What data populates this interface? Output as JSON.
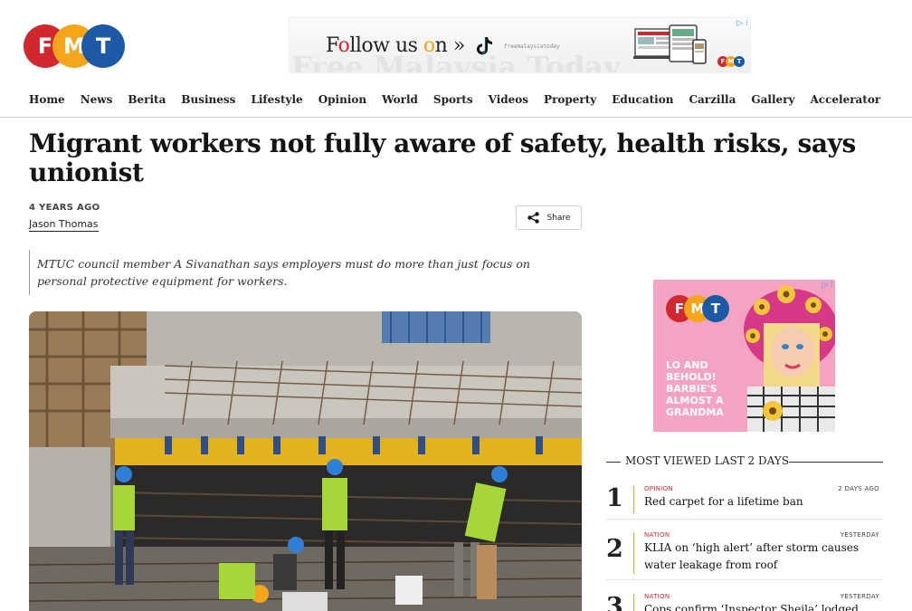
{
  "logo": {
    "letters": [
      "F",
      "M",
      "T"
    ],
    "colors": [
      "#d0282e",
      "#f4a51c",
      "#1d5aa6"
    ]
  },
  "top_ad": {
    "follow_text_pre": "F",
    "follow_text_o": "o",
    "follow_text_mid": "llow us ",
    "follow_text_o2": "o",
    "follow_text_post": "n »",
    "handle": "freemalaysiatoday",
    "ghost_text": "Free Malaysia Today",
    "tiktok_icon": "tiktok-icon",
    "adchoices_label": "▷ ⁝"
  },
  "nav": {
    "items": [
      "Home",
      "News",
      "Berita",
      "Business",
      "Lifestyle",
      "Opinion",
      "World",
      "Sports",
      "Videos",
      "Property",
      "Education",
      "Carzilla",
      "Gallery",
      "Accelerator"
    ]
  },
  "article": {
    "title": "Migrant workers not fully aware of safety, health risks, says unionist",
    "date": "4 YEARS AGO",
    "author": "Jason Thomas",
    "share_label": "Share",
    "standfirst": "MTUC council member A Sivanathan says employers must do more than just focus on personal protective equipment for workers."
  },
  "side_ad": {
    "headline": "LO AND BEHOLD! BARBIE'S ALMOST A GRANDMA",
    "adchoices_label": "▷ ⁝"
  },
  "most_viewed": {
    "title": "MOST VIEWED LAST 2 DAYS",
    "items": [
      {
        "rank": "1",
        "category": "OPINION",
        "when": "2 DAYS AGO",
        "title": "Red carpet for a lifetime ban"
      },
      {
        "rank": "2",
        "category": "NATION",
        "when": "YESTERDAY",
        "title": "KLIA on ‘high alert’ after storm causes water leakage from roof"
      },
      {
        "rank": "3",
        "category": "NATION",
        "when": "YESTERDAY",
        "title": "Cops confirm ‘Inspector Sheila’ lodged report"
      }
    ]
  },
  "colors": {
    "brand_red": "#d0282e",
    "brand_yellow": "#f4a51c",
    "brand_blue": "#1d5aa6",
    "ad_pink": "#f5a3c3"
  }
}
